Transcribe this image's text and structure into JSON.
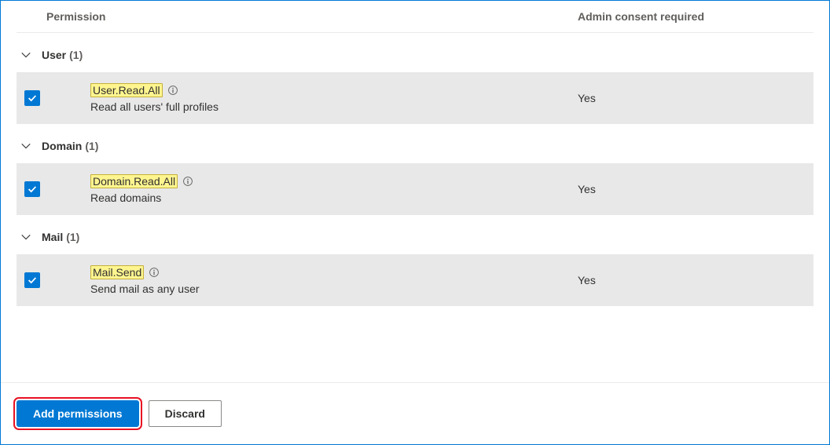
{
  "headers": {
    "permission": "Permission",
    "consent": "Admin consent required"
  },
  "groups": [
    {
      "name": "User",
      "count": "(1)",
      "items": [
        {
          "name": "User.Read.All",
          "description": "Read all users' full profiles",
          "consent": "Yes",
          "checked": true
        }
      ]
    },
    {
      "name": "Domain",
      "count": "(1)",
      "items": [
        {
          "name": "Domain.Read.All",
          "description": "Read domains",
          "consent": "Yes",
          "checked": true
        }
      ]
    },
    {
      "name": "Mail",
      "count": "(1)",
      "items": [
        {
          "name": "Mail.Send",
          "description": "Send mail as any user",
          "consent": "Yes",
          "checked": true
        }
      ]
    }
  ],
  "buttons": {
    "add": "Add permissions",
    "discard": "Discard"
  }
}
